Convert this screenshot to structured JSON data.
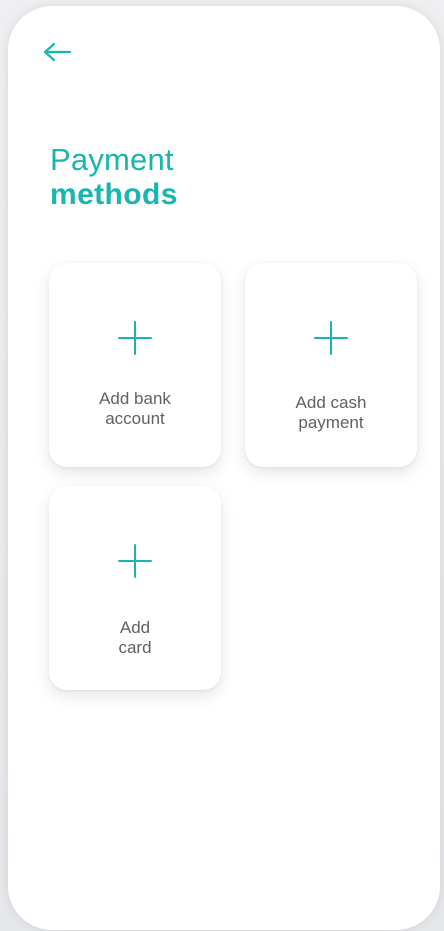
{
  "screen": {
    "title_line_1": "Payment",
    "title_line_2": "methods"
  },
  "actions": {
    "back_icon": "arrow-left"
  },
  "payment_options": [
    {
      "label_line_1": "Add bank",
      "label_line_2": "account",
      "icon": "plus"
    },
    {
      "label_line_1": "Add cash",
      "label_line_2": "payment",
      "icon": "plus"
    },
    {
      "label_line_1": "Add",
      "label_line_2": "card",
      "icon": "plus"
    }
  ],
  "theme": {
    "accent": "#19b5b0",
    "text_secondary": "#5f6163",
    "card_background": "#ffffff",
    "page_background": "#e9eaec"
  }
}
